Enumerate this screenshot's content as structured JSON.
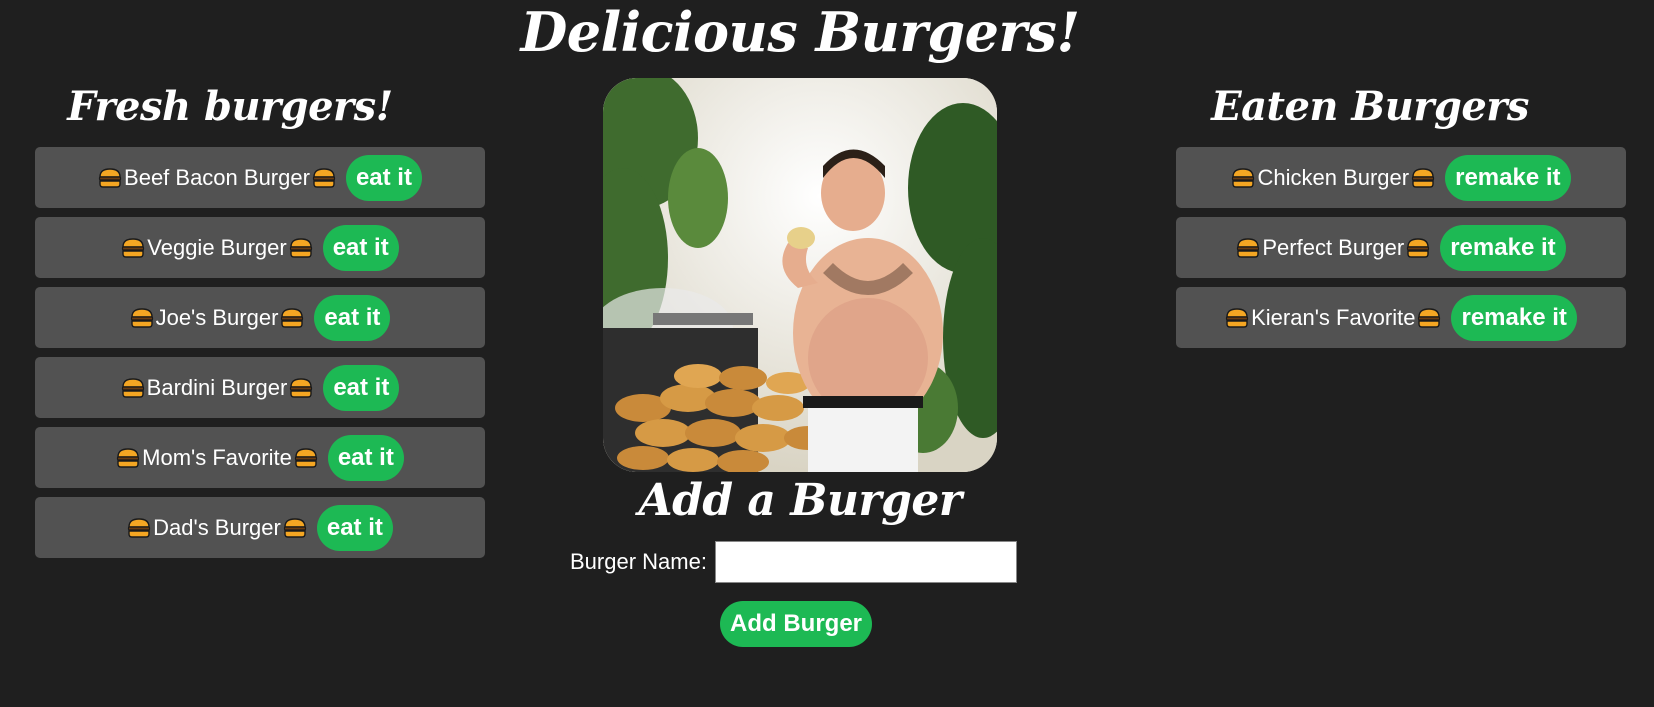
{
  "header": {
    "title": "Delicious Burgers!"
  },
  "fresh": {
    "title": "Fresh burgers!",
    "button_label": "eat it",
    "items": [
      {
        "name": "Beef Bacon Burger"
      },
      {
        "name": "Veggie Burger"
      },
      {
        "name": "Joe's Burger"
      },
      {
        "name": "Bardini Burger"
      },
      {
        "name": "Mom's Favorite"
      },
      {
        "name": "Dad's Burger"
      }
    ]
  },
  "eaten": {
    "title": "Eaten Burgers",
    "button_label": "remake it",
    "items": [
      {
        "name": "Chicken Burger"
      },
      {
        "name": "Perfect Burger"
      },
      {
        "name": "Kieran's Favorite"
      }
    ]
  },
  "add_form": {
    "title": "Add a Burger",
    "label": "Burger Name:",
    "value": "",
    "button_label": "Add Burger"
  },
  "icons": {
    "item_icon": "burger-icon"
  },
  "colors": {
    "background": "#1f1f1f",
    "card": "#525252",
    "accent": "#1db954"
  }
}
